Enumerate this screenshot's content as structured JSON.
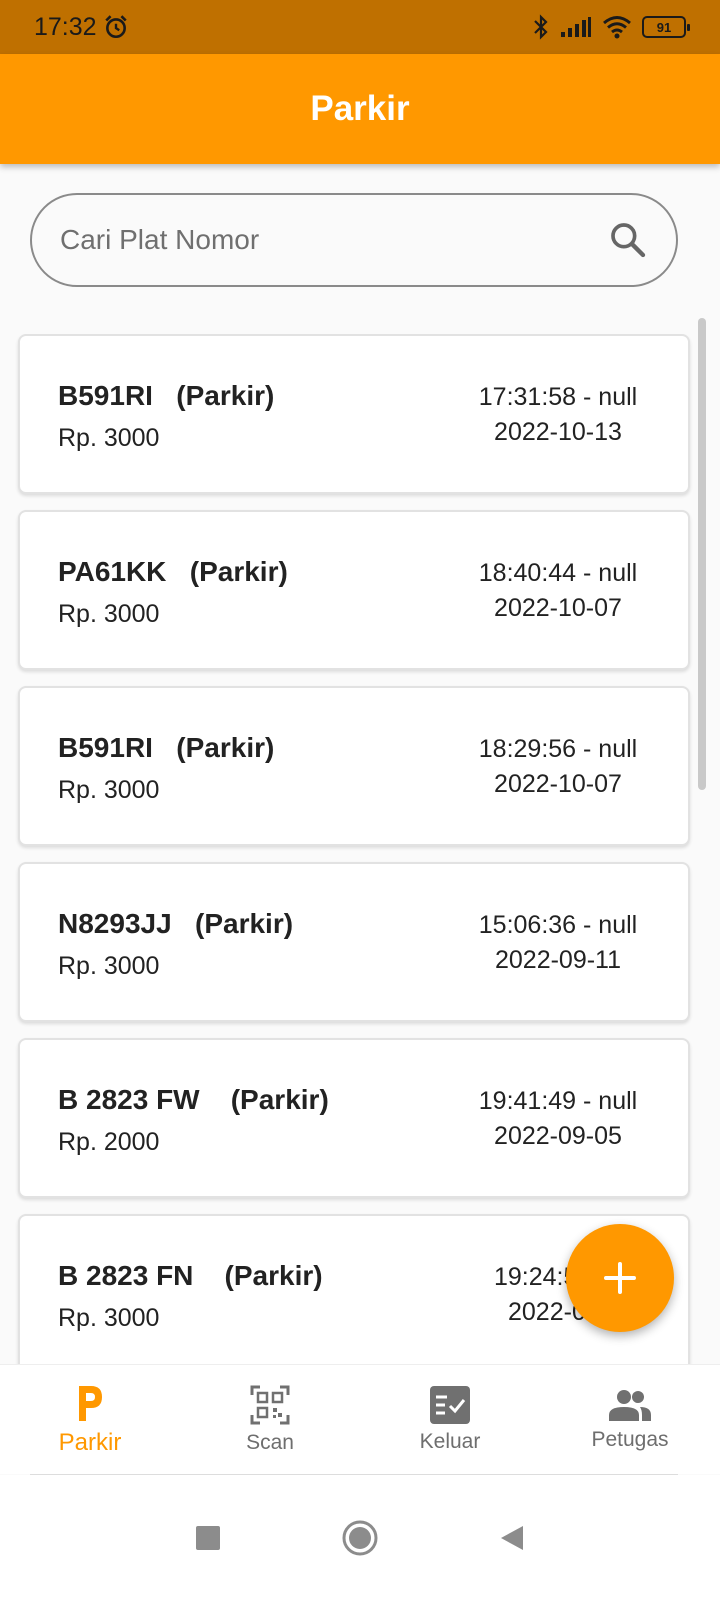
{
  "status_bar": {
    "time": "17:32",
    "battery": "91"
  },
  "app_bar": {
    "title": "Parkir"
  },
  "search": {
    "placeholder": "Cari Plat Nomor"
  },
  "parking_list": [
    {
      "plate": "B591RI",
      "status": "(Parkir)",
      "price": "Rp. 3000",
      "time": "17:31:58 - null",
      "date": "2022-10-13"
    },
    {
      "plate": "PA61KK",
      "status": "(Parkir)",
      "price": "Rp. 3000",
      "time": "18:40:44 - null",
      "date": "2022-10-07"
    },
    {
      "plate": "B591RI",
      "status": "(Parkir)",
      "price": "Rp. 3000",
      "time": "18:29:56 - null",
      "date": "2022-10-07"
    },
    {
      "plate": "N8293JJ",
      "status": "(Parkir)",
      "price": "Rp. 3000",
      "time": "15:06:36 - null",
      "date": "2022-09-11"
    },
    {
      "plate": "B 2823 FW",
      "status": "(Parkir)",
      "price": "Rp. 2000",
      "time": "19:41:49 - null",
      "date": "2022-09-05"
    },
    {
      "plate": "B 2823 FN",
      "status": "(Parkir)",
      "price": "Rp. 3000",
      "time": "19:24:5",
      "date": "2022-0"
    }
  ],
  "fab": {
    "icon": "plus-icon"
  },
  "bottom_nav": [
    {
      "label": "Parkir",
      "icon": "parking-icon",
      "active": true
    },
    {
      "label": "Scan",
      "icon": "qr-scan-icon",
      "active": false
    },
    {
      "label": "Keluar",
      "icon": "checklist-icon",
      "active": false
    },
    {
      "label": "Petugas",
      "icon": "people-icon",
      "active": false
    }
  ],
  "colors": {
    "primary": "#ff9800",
    "status_bar": "#bf7000",
    "inactive": "#6e6e6e"
  }
}
